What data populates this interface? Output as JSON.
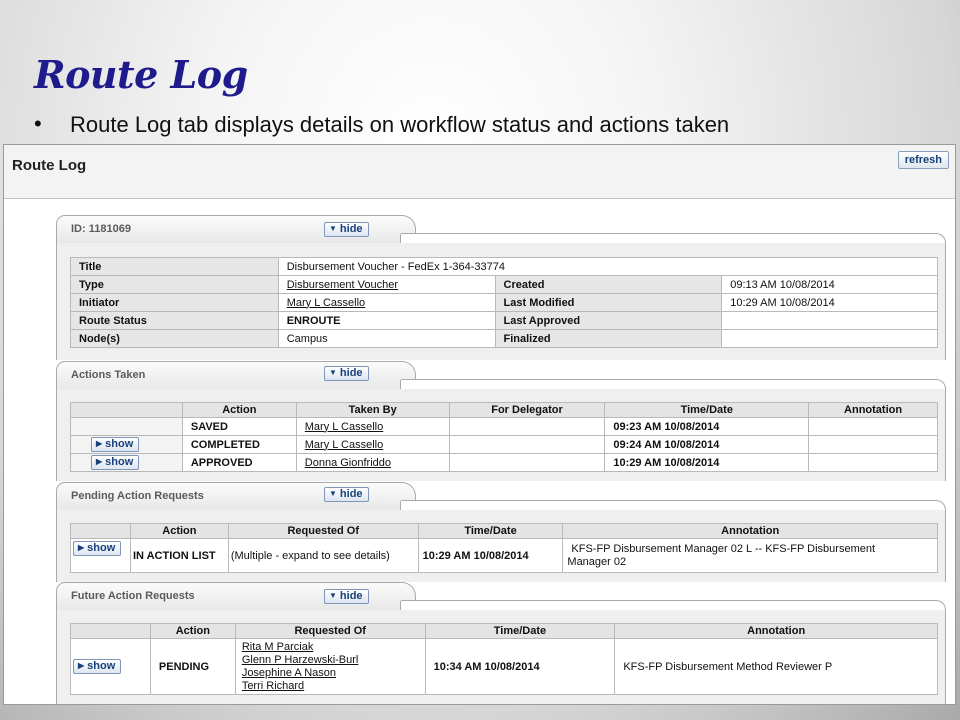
{
  "slide": {
    "title": "Route Log",
    "bullet": "Route Log tab displays details on workflow status and actions taken"
  },
  "app": {
    "page_heading": "Route Log",
    "refresh_label": "refresh"
  },
  "colors": {
    "title": "#1f1b8c",
    "button_text": "#17407a",
    "panel_bg": "#efefef"
  },
  "icons": {
    "expanded": "triangle-down-icon",
    "collapsed": "triangle-right-icon"
  },
  "id_section": {
    "tab_label": "ID: 1181069",
    "hide_label": "hide",
    "rows": {
      "title_label": "Title",
      "title_value": "Disbursement Voucher - FedEx 1-364-33774",
      "type_label": "Type",
      "type_value": "Disbursement Voucher",
      "created_label": "Created",
      "created_value": "09:13 AM 10/08/2014",
      "initiator_label": "Initiator",
      "initiator_value": "Mary L Cassello",
      "last_modified_label": "Last Modified",
      "last_modified_value": "10:29 AM 10/08/2014",
      "route_status_label": "Route Status",
      "route_status_value": "ENROUTE",
      "last_approved_label": "Last Approved",
      "last_approved_value": "",
      "nodes_label": "Node(s)",
      "nodes_value": "Campus",
      "finalized_label": "Finalized",
      "finalized_value": ""
    }
  },
  "actions_taken": {
    "tab_label": "Actions Taken",
    "hide_label": "hide",
    "headers": [
      "",
      "Action",
      "Taken By",
      "For Delegator",
      "Time/Date",
      "Annotation"
    ],
    "show_label": "show",
    "rows": [
      {
        "show": "",
        "action": "SAVED",
        "taken_by": "Mary L Cassello",
        "for_delegator": "",
        "time": "09:23 AM 10/08/2014",
        "annotation": ""
      },
      {
        "show": "show",
        "action": "COMPLETED",
        "taken_by": "Mary L Cassello",
        "for_delegator": "",
        "time": "09:24 AM 10/08/2014",
        "annotation": ""
      },
      {
        "show": "show",
        "action": "APPROVED",
        "taken_by": "Donna Gionfriddo",
        "for_delegator": "",
        "time": "10:29 AM 10/08/2014",
        "annotation": ""
      }
    ]
  },
  "pending_requests": {
    "tab_label": "Pending Action Requests",
    "hide_label": "hide",
    "headers": [
      "",
      "Action",
      "Requested Of",
      "Time/Date",
      "Annotation"
    ],
    "row": {
      "show": "show",
      "action": "IN ACTION LIST",
      "requested_of": "(Multiple - expand to see details)",
      "time": "10:29 AM 10/08/2014",
      "annotation_line1": "KFS-FP Disbursement Manager 02 L -- KFS-FP Disbursement",
      "annotation_line2": "Manager 02"
    }
  },
  "future_requests": {
    "tab_label": "Future Action Requests",
    "hide_label": "hide",
    "headers": [
      "",
      "Action",
      "Requested Of",
      "Time/Date",
      "Annotation"
    ],
    "row": {
      "show": "show",
      "action": "PENDING",
      "requested_of": [
        "Rita M Parciak",
        "Glenn P Harzewski-Burl",
        "Josephine A Nason",
        "Terri Richard"
      ],
      "time": "10:34 AM 10/08/2014",
      "annotation": "KFS-FP Disbursement Method Reviewer P"
    }
  }
}
